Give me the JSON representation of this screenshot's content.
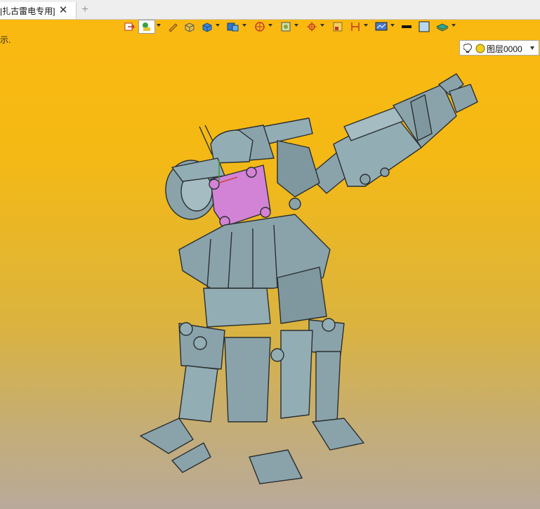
{
  "tabbar": {
    "tab_title": "|扎古雷电专用]",
    "close_glyph": "✕",
    "new_tab_glyph": "+"
  },
  "viewport": {
    "hint_text": "示.",
    "background_top": "#fbb910",
    "background_bottom": "#b9a99a"
  },
  "toolbar": {
    "layer_select_value": "图层0000",
    "icons": [
      "exit-icon",
      "filter-icon",
      "pen-icon",
      "box-yellow-icon",
      "box-blue-icon",
      "display-icon",
      "sphere-icon",
      "render-icon",
      "crosshair-icon",
      "frame-icon",
      "measure-icon",
      "screen-icon",
      "line-style-icon",
      "color-swatch-icon",
      "layer-stack-icon",
      "bulb-icon"
    ]
  },
  "model": {
    "name": "",
    "body_color": "#8aa3ab",
    "highlight_color": "#d283d6",
    "outline_color": "#2a2f31"
  }
}
